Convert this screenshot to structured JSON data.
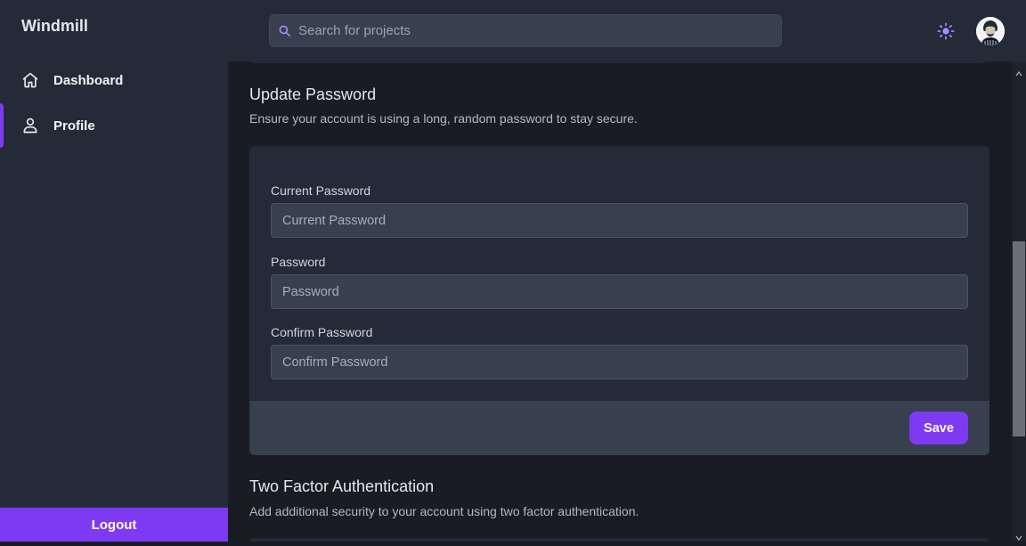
{
  "app": {
    "title": "Windmill"
  },
  "sidebar": {
    "items": [
      {
        "label": "Dashboard",
        "icon": "home-icon",
        "active": false
      },
      {
        "label": "Profile",
        "icon": "user-icon",
        "active": true
      }
    ],
    "logout_label": "Logout"
  },
  "header": {
    "search": {
      "placeholder": "Search for projects",
      "value": ""
    },
    "theme_icon": "sun-icon",
    "avatar_icon": "avatar"
  },
  "update_password": {
    "title": "Update Password",
    "description": "Ensure your account is using a long, random password to stay secure.",
    "fields": [
      {
        "label": "Current Password",
        "placeholder": "Current Password",
        "value": ""
      },
      {
        "label": "Password",
        "placeholder": "Password",
        "value": ""
      },
      {
        "label": "Confirm Password",
        "placeholder": "Confirm Password",
        "value": ""
      }
    ],
    "save_label": "Save"
  },
  "two_factor": {
    "title": "Two Factor Authentication",
    "description": "Add additional security to your account using two factor authentication."
  },
  "colors": {
    "accent": "#7e3af2",
    "background": "#1a1c23",
    "panel": "#252a39",
    "input": "#383f4f"
  }
}
